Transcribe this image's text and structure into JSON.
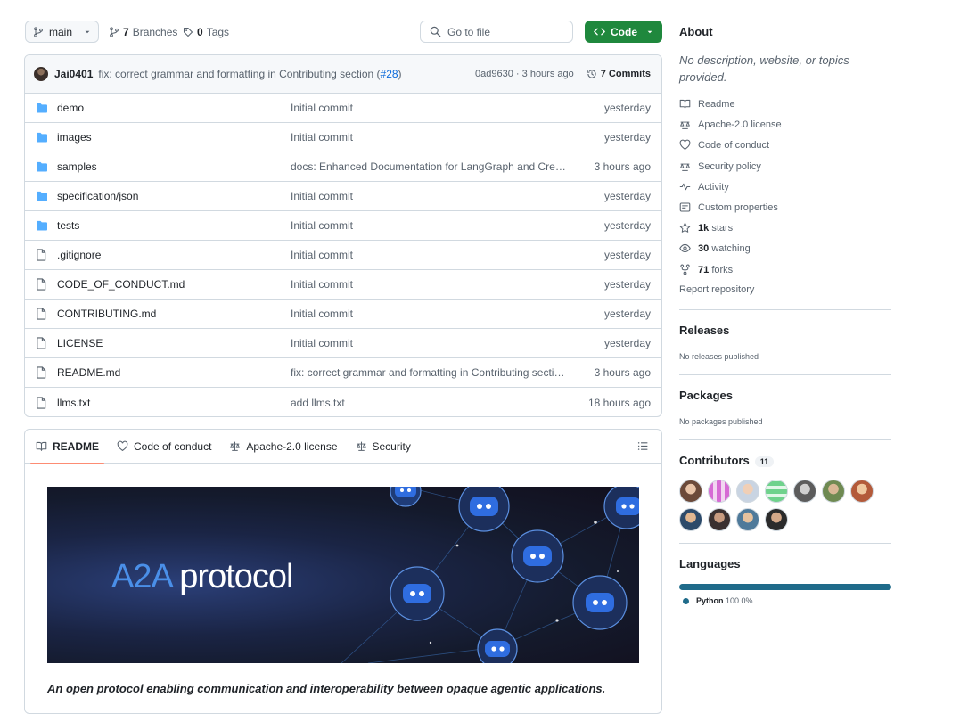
{
  "toolbar": {
    "branch": "main",
    "branches_count": "7",
    "branches_label": "Branches",
    "tags_count": "0",
    "tags_label": "Tags",
    "goto_placeholder": "Go to file",
    "code_label": "Code"
  },
  "latest_commit": {
    "author": "Jai0401",
    "message": "fix: correct grammar and formatting in Contributing section (",
    "pr": "#28",
    "message_end": ")",
    "sha": "0ad9630 · 3 hours ago",
    "commits_label": "7 Commits"
  },
  "files": [
    {
      "type": "dir",
      "name": "demo",
      "message": "Initial commit",
      "time": "yesterday"
    },
    {
      "type": "dir",
      "name": "images",
      "message": "Initial commit",
      "time": "yesterday"
    },
    {
      "type": "dir",
      "name": "samples",
      "message": "docs: Enhanced Documentation for LangGraph and Crew...",
      "time": "3 hours ago"
    },
    {
      "type": "dir",
      "name": "specification/json",
      "message": "Initial commit",
      "time": "yesterday"
    },
    {
      "type": "dir",
      "name": "tests",
      "message": "Initial commit",
      "time": "yesterday"
    },
    {
      "type": "file",
      "name": ".gitignore",
      "message": "Initial commit",
      "time": "yesterday"
    },
    {
      "type": "file",
      "name": "CODE_OF_CONDUCT.md",
      "message": "Initial commit",
      "time": "yesterday"
    },
    {
      "type": "file",
      "name": "CONTRIBUTING.md",
      "message": "Initial commit",
      "time": "yesterday"
    },
    {
      "type": "file",
      "name": "LICENSE",
      "message": "Initial commit",
      "time": "yesterday"
    },
    {
      "type": "file",
      "name": "README.md",
      "message": "fix: correct grammar and formatting in Contributing sectio...",
      "time": "3 hours ago"
    },
    {
      "type": "file",
      "name": "llms.txt",
      "message": "add llms.txt",
      "time": "18 hours ago"
    }
  ],
  "readme": {
    "tabs": [
      "README",
      "Code of conduct",
      "Apache-2.0 license",
      "Security"
    ],
    "banner_a2a": "A2A",
    "banner_protocol": " protocol",
    "tagline": "An open protocol enabling communication and interoperability between opaque agentic applications."
  },
  "about": {
    "title": "About",
    "description": "No description, website, or topics provided.",
    "readme": "Readme",
    "license": "Apache-2.0 license",
    "conduct": "Code of conduct",
    "security": "Security policy",
    "activity": "Activity",
    "custom": "Custom properties",
    "stars_count": "1k",
    "stars_label": "stars",
    "watching_count": "30",
    "watching_label": "watching",
    "forks_count": "71",
    "forks_label": "forks",
    "report": "Report repository"
  },
  "releases": {
    "title": "Releases",
    "note": "No releases published"
  },
  "packages": {
    "title": "Packages",
    "note": "No packages published"
  },
  "contributors": {
    "title": "Contributors",
    "count": "11"
  },
  "languages": {
    "title": "Languages",
    "name": "Python",
    "percent": "100.0%",
    "color": "#1f6b8a"
  },
  "colors": {
    "accent_green": "#1f883d",
    "link_blue": "#0969da",
    "folder_blue": "#54aeff"
  }
}
